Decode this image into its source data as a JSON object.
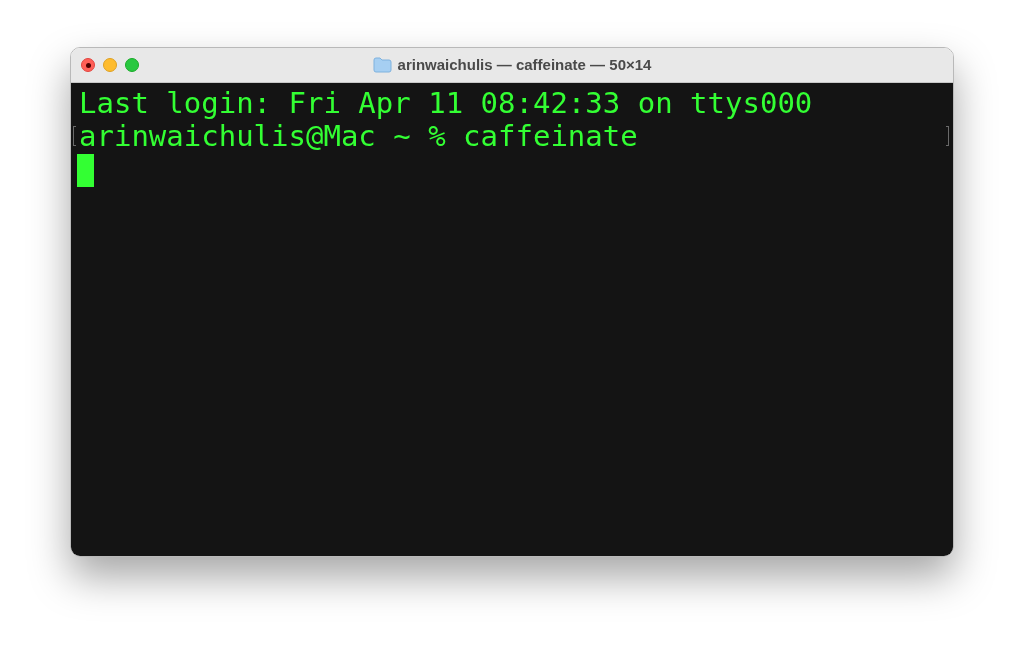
{
  "window": {
    "title": "arinwaichulis — caffeinate — 50×14"
  },
  "terminal": {
    "lines": [
      {
        "text": "Last login: Fri Apr 11 08:42:33 on ttys000",
        "marked": false
      },
      {
        "text": "arinwaichulis@Mac ~ % caffeinate",
        "marked": true
      }
    ],
    "cursor": true
  }
}
